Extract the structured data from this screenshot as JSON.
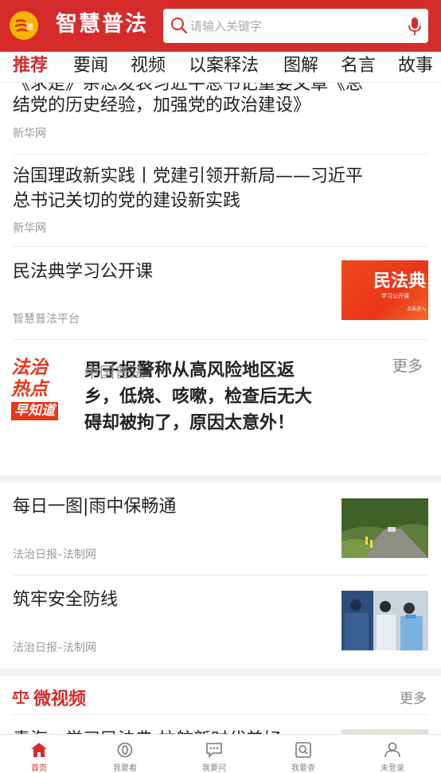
{
  "app": {
    "title": "智慧普法",
    "logo_text": "法"
  },
  "search": {
    "placeholder": "请输入关键字"
  },
  "tabs": [
    "推荐",
    "要闻",
    "视频",
    "以案释法",
    "图解",
    "名言",
    "故事"
  ],
  "articles": [
    {
      "title_line1": "《求是》杂志发表习近平总书记重要文章《总",
      "title_line2": "结党的历史经验，加强党的政治建设》",
      "source": "新华网"
    },
    {
      "title_line1": "治国理政新实践丨党建引领开新局——习近平",
      "title_line2": "总书记关切的党的建设新实践",
      "source": "新华网"
    },
    {
      "title": "民法典学习公开课",
      "source": "智慧普法平台",
      "thumb_text": "民法典",
      "thumb_sub": "学习公开课",
      "thumb_hint": "点击进入"
    }
  ],
  "hot": {
    "logo_lines": [
      "法治",
      "热点",
      "早知道"
    ],
    "title_line1": "男子报警称从高风险地区返",
    "title_line2": "乡，低烧、咳嗽，检查后无大",
    "title_line3": "碍却被拘了，原因太意外！",
    "source": "中国普法",
    "more": "更多"
  },
  "articles2": [
    {
      "title": "每日一图|雨中保畅通",
      "source": "法治日报–法制网"
    },
    {
      "title": "筑牢安全防线",
      "source": "法治日报–法制网"
    }
  ],
  "micro_video": {
    "title": "微视频",
    "more": "更多",
    "first_title": "青海：学习民法典 拉航新时代美好"
  },
  "bottom_nav": [
    {
      "label": "首页",
      "icon": "home-icon"
    },
    {
      "label": "我要看",
      "icon": "compass-icon"
    },
    {
      "label": "我要问",
      "icon": "chat-icon"
    },
    {
      "label": "我要查",
      "icon": "search-doc-icon"
    },
    {
      "label": "未登录",
      "icon": "user-icon"
    }
  ],
  "colors": {
    "brand": "#d52b2b",
    "accent": "#f5b400"
  }
}
